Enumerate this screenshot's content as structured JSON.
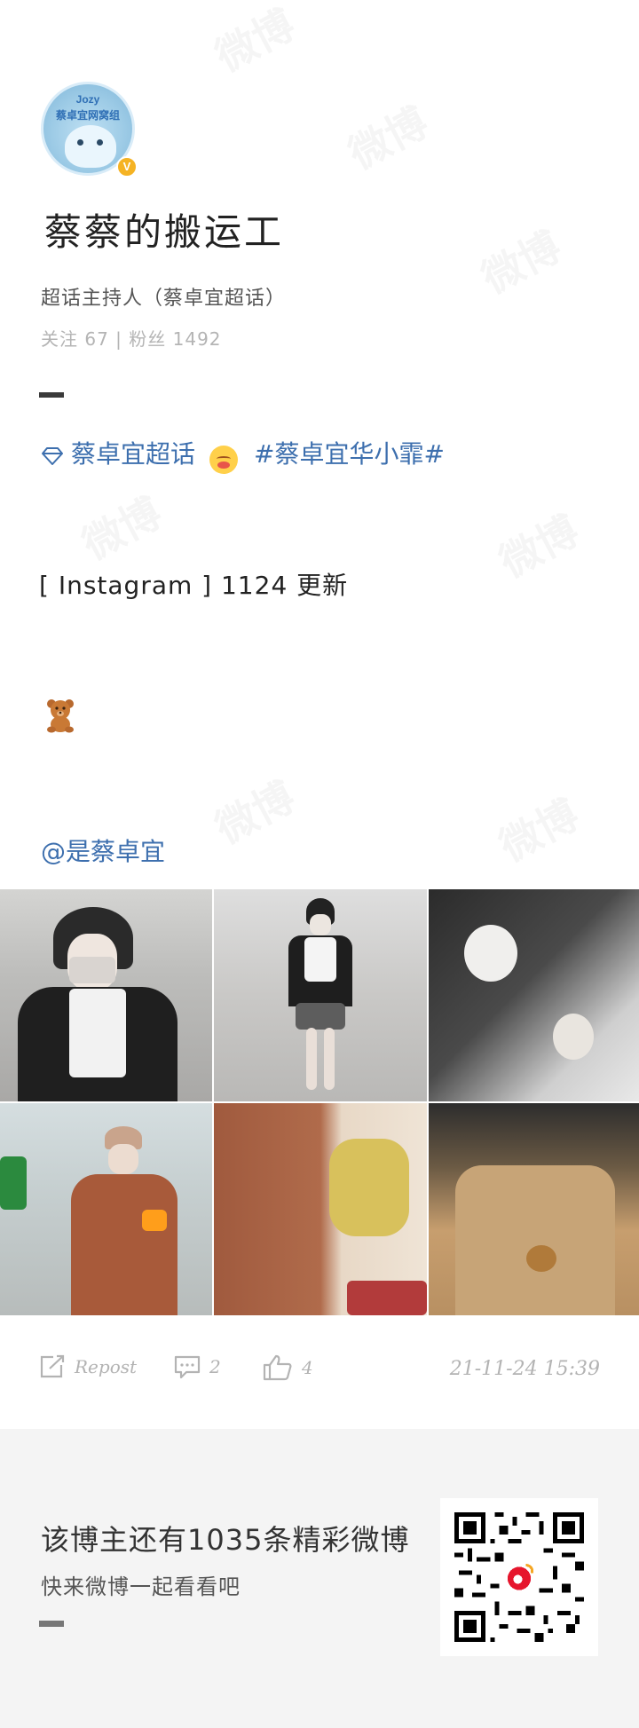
{
  "header": {
    "avatar_tag_line1": "Jozy",
    "avatar_tag_line2": "蔡卓宜网窝组",
    "verified_badge": "V",
    "username": "蔡蔡的搬运工",
    "role": "超话主持人（蔡卓宜超话）",
    "stats": "关注 67 | 粉丝 1492"
  },
  "post": {
    "topic_1": "蔡卓宜超话",
    "topic_2": "#蔡卓宜华小霏#",
    "text": "[ Instagram ] 1124 更新",
    "mention": "@是蔡卓宜",
    "icons": [
      "diamond-icon",
      "blush-emoji-icon",
      "teddy-bear-icon"
    ]
  },
  "photos": [
    {
      "alt": "photo-1"
    },
    {
      "alt": "photo-2"
    },
    {
      "alt": "photo-3"
    },
    {
      "alt": "photo-4"
    },
    {
      "alt": "photo-5"
    },
    {
      "alt": "photo-6"
    }
  ],
  "actions": {
    "repost_label": "Repost",
    "comment_count": "2",
    "like_count": "4",
    "timestamp": "21-11-24 15:39"
  },
  "footer": {
    "promo_line1": "该博主还有1035条精彩微博",
    "promo_line2": "快来微博一起看看吧",
    "watermark_text": "微博 weibo.com"
  },
  "colors": {
    "link_blue": "#3d6fae",
    "muted_gray": "#b3b3b3",
    "footer_bg": "#f4f4f4",
    "badge_orange": "#f5b324"
  }
}
